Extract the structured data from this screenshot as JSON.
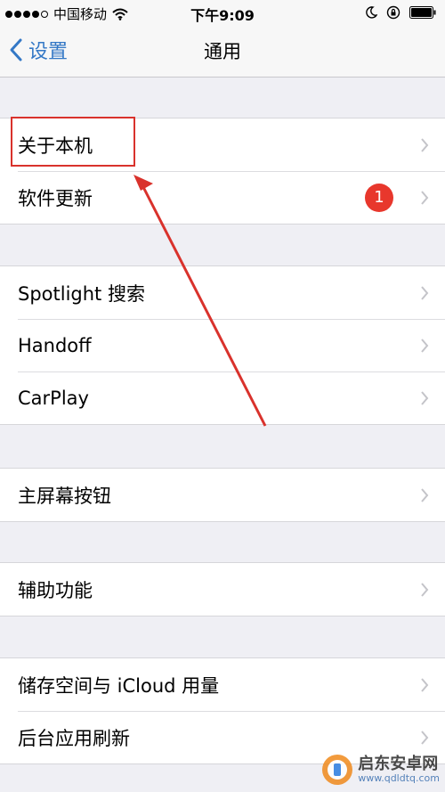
{
  "status_bar": {
    "carrier": "中国移动",
    "time": "下午9:09"
  },
  "nav": {
    "back_label": "设置",
    "title": "通用"
  },
  "groups": [
    {
      "rows": [
        {
          "label": "关于本机"
        },
        {
          "label": "软件更新",
          "badge": "1"
        }
      ]
    },
    {
      "rows": [
        {
          "label": "Spotlight 搜索"
        },
        {
          "label": "Handoff"
        },
        {
          "label": "CarPlay"
        }
      ]
    },
    {
      "rows": [
        {
          "label": "主屏幕按钮"
        }
      ]
    },
    {
      "rows": [
        {
          "label": "辅助功能"
        }
      ]
    },
    {
      "rows": [
        {
          "label": "储存空间与 iCloud 用量"
        },
        {
          "label": "后台应用刷新"
        }
      ]
    }
  ],
  "watermark": {
    "name": "启东安卓网",
    "url": "www.qdldtq.com"
  },
  "colors": {
    "accent": "#3478c6",
    "badge": "#e8372c",
    "annotation": "#d9322c",
    "background": "#efeff4"
  }
}
